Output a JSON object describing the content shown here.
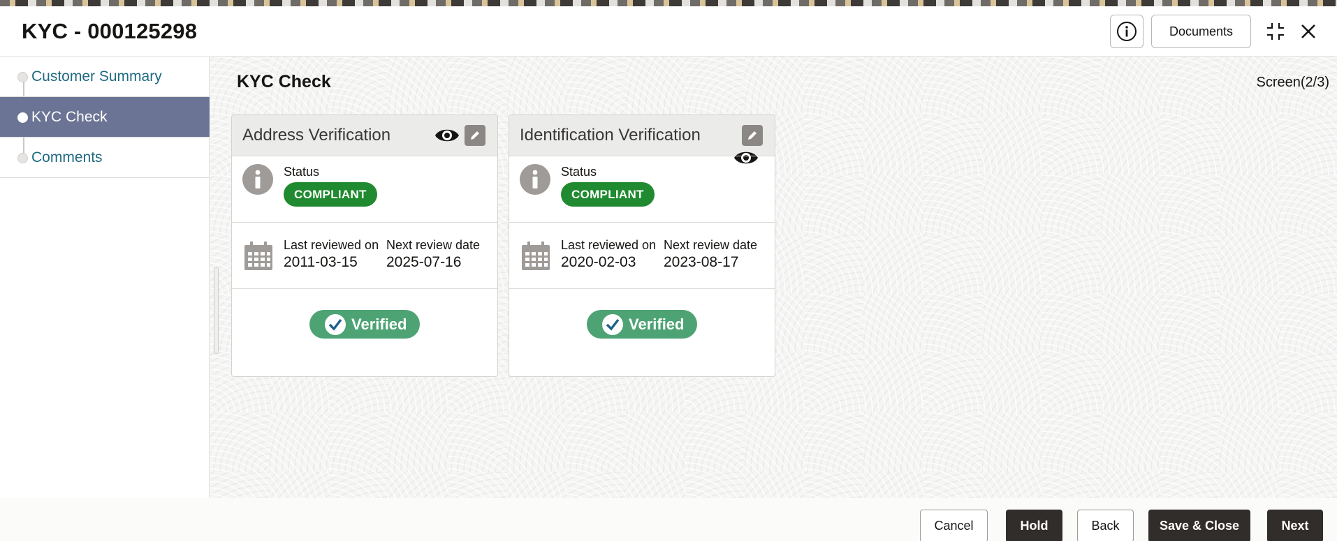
{
  "window": {
    "title": "KYC - 000125298"
  },
  "header": {
    "documents_label": "Documents"
  },
  "sidebar": {
    "items": [
      {
        "label": "Customer Summary",
        "active": false
      },
      {
        "label": "KYC Check",
        "active": true
      },
      {
        "label": "Comments",
        "active": false
      }
    ]
  },
  "main": {
    "title": "KYC Check",
    "screen_indicator": "Screen(2/3)"
  },
  "cards": [
    {
      "title": "Address Verification",
      "status_label": "Status",
      "status": "COMPLIANT",
      "last_reviewed_label": "Last reviewed on",
      "last_reviewed": "2011-03-15",
      "next_review_label": "Next review date",
      "next_review": "2025-07-16",
      "verified_label": "Verified"
    },
    {
      "title": "Identification Verification",
      "status_label": "Status",
      "status": "COMPLIANT",
      "last_reviewed_label": "Last reviewed on",
      "last_reviewed": "2020-02-03",
      "next_review_label": "Next review date",
      "next_review": "2023-08-17",
      "verified_label": "Verified"
    }
  ],
  "footer": {
    "cancel": "Cancel",
    "hold": "Hold",
    "back": "Back",
    "save_close": "Save & Close",
    "next": "Next"
  },
  "colors": {
    "active_sidebar": "#6b7494",
    "compliant_badge": "#1f8a2f",
    "verified_pill": "#4ea374",
    "primary_button": "#312d2a",
    "link": "#1f6a80"
  },
  "icons": [
    "info-icon",
    "maximize-icon",
    "close-icon",
    "eye-icon",
    "pencil-icon",
    "calendar-icon",
    "checkmark-icon"
  ]
}
